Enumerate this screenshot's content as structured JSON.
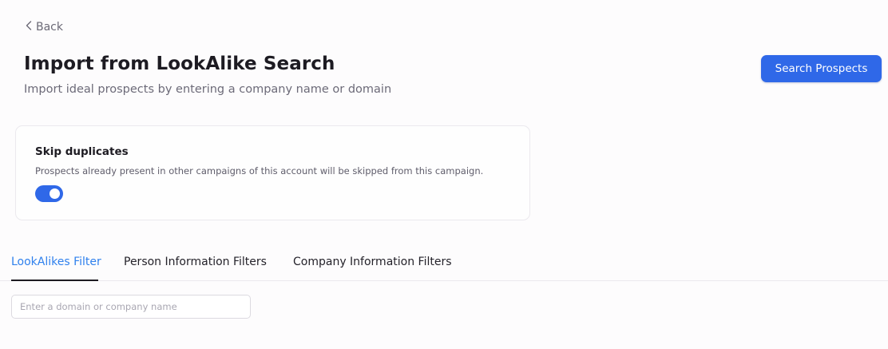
{
  "nav": {
    "back_label": "Back"
  },
  "header": {
    "title": "Import from LookAlike Search",
    "subtitle": "Import ideal prospects by entering a company name or domain",
    "search_button_label": "Search Prospects"
  },
  "skip_duplicates": {
    "title": "Skip duplicates",
    "description": "Prospects already present in other campaigns of this account will be skipped from this campaign.",
    "enabled": true
  },
  "tabs": [
    {
      "label": "LookAlikes Filter",
      "active": true
    },
    {
      "label": "Person Information Filters",
      "active": false
    },
    {
      "label": "Company Information Filters",
      "active": false
    }
  ],
  "lookalike_filter": {
    "input_value": "",
    "input_placeholder": "Enter a domain or company name"
  },
  "icons": {
    "back": "chevron-left-icon"
  },
  "colors": {
    "primary": "#2f68e8",
    "active_tab": "#2f80ed",
    "page_background": "#fdfcfd"
  }
}
